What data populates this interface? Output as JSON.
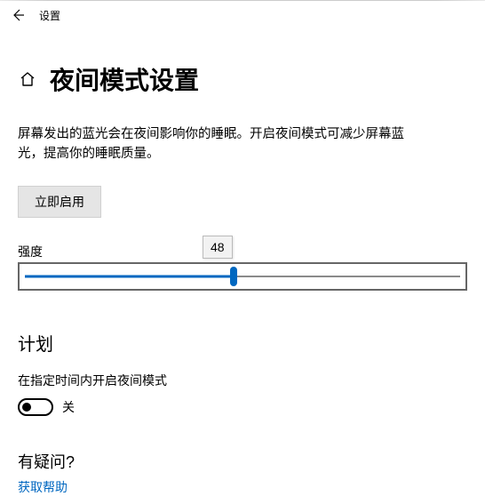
{
  "window": {
    "title": "设置"
  },
  "page": {
    "heading": "夜间模式设置",
    "description": "屏幕发出的蓝光会在夜间影响你的睡眠。开启夜间模式可减少屏幕蓝光，提高你的睡眠质量。",
    "enable_button": "立即启用"
  },
  "slider": {
    "label": "强度",
    "value": "48"
  },
  "schedule": {
    "heading": "计划",
    "desc": "在指定时间内开启夜间模式",
    "state": "关"
  },
  "help": {
    "heading": "有疑问?",
    "link": "获取帮助"
  }
}
